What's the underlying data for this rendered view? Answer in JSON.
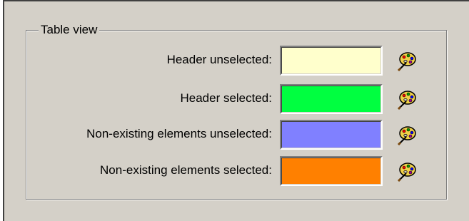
{
  "group": {
    "title": "Table view"
  },
  "rows": [
    {
      "label": "Header unselected:",
      "color": "#ffffcc",
      "icon": "palette-icon"
    },
    {
      "label": "Header selected:",
      "color": "#00ff40",
      "icon": "palette-icon"
    },
    {
      "label": "Non-existing elements unselected:",
      "color": "#8080ff",
      "icon": "palette-icon"
    },
    {
      "label": "Non-existing elements selected:",
      "color": "#ff8000",
      "icon": "palette-icon"
    }
  ]
}
